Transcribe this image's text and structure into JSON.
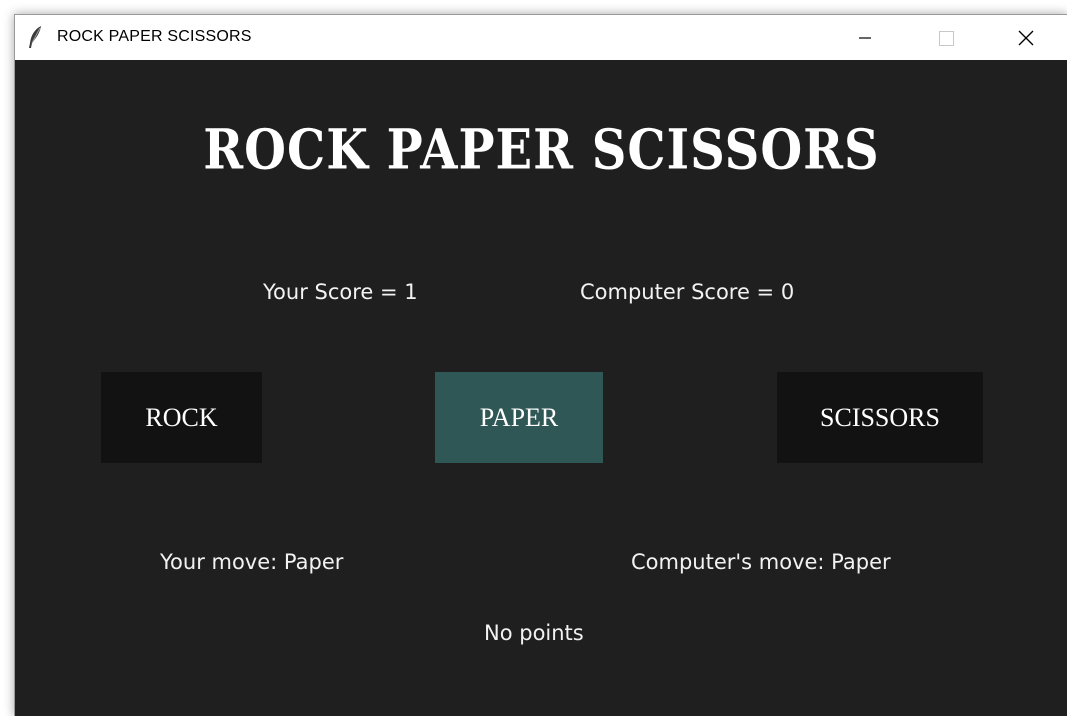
{
  "window": {
    "title": "ROCK PAPER SCISSORS",
    "icons": {
      "app": "feather-icon",
      "minimize": "minimize-icon",
      "maximize": "maximize-icon",
      "close": "close-icon"
    }
  },
  "game": {
    "heading": "ROCK PAPER SCISSORS",
    "your_score": "Your Score = 1",
    "computer_score": "Computer Score = 0",
    "buttons": {
      "rock": "ROCK",
      "paper": "PAPER",
      "scissors": "SCISSORS"
    },
    "your_move": "Your move: Paper",
    "computer_move": "Computer's move: Paper",
    "result": "No points"
  },
  "colors": {
    "background": "#1f1f1f",
    "button": "#121212",
    "button_active": "#2f5755",
    "text": "#ffffff"
  }
}
